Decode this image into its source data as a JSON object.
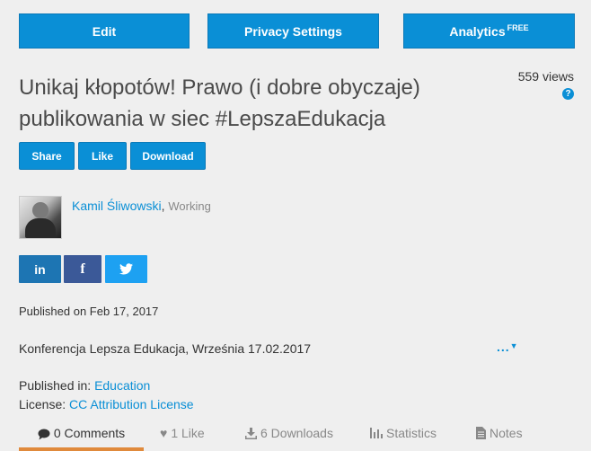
{
  "toolbar": {
    "edit_label": "Edit",
    "privacy_label": "Privacy Settings",
    "analytics_label": "Analytics",
    "analytics_badge": "FREE"
  },
  "presentation": {
    "title": "Unikaj kłopotów! Prawo (i dobre obyczaje) publikowania w siec #LepszaEdukacja",
    "views": "559 views",
    "help_glyph": "?"
  },
  "actions": {
    "share_label": "Share",
    "like_label": "Like",
    "download_label": "Download"
  },
  "author": {
    "name": "Kamil Śliwowski",
    "separator": ", ",
    "organization": "Working"
  },
  "social": {
    "linkedin_glyph": "in",
    "facebook_glyph": "f",
    "twitter_glyph": "🐦"
  },
  "details": {
    "published_on": "Published on Feb 17, 2017",
    "description": "Konferencja Lepsza Edukacja, Września 17.02.2017",
    "more_label": "...",
    "published_in_label": "Published in:",
    "published_in_value": "Education",
    "license_label": "License:",
    "license_value": "CC Attribution License"
  },
  "tabs": {
    "comments": "0 Comments",
    "likes": "1 Like",
    "downloads": "6 Downloads",
    "statistics": "Statistics",
    "notes": "Notes"
  },
  "colors": {
    "primary": "#0a8fd6",
    "active_tab": "#e08a3c",
    "linkedin": "#1d75b3",
    "facebook": "#3b5998",
    "twitter": "#1da1f2"
  }
}
